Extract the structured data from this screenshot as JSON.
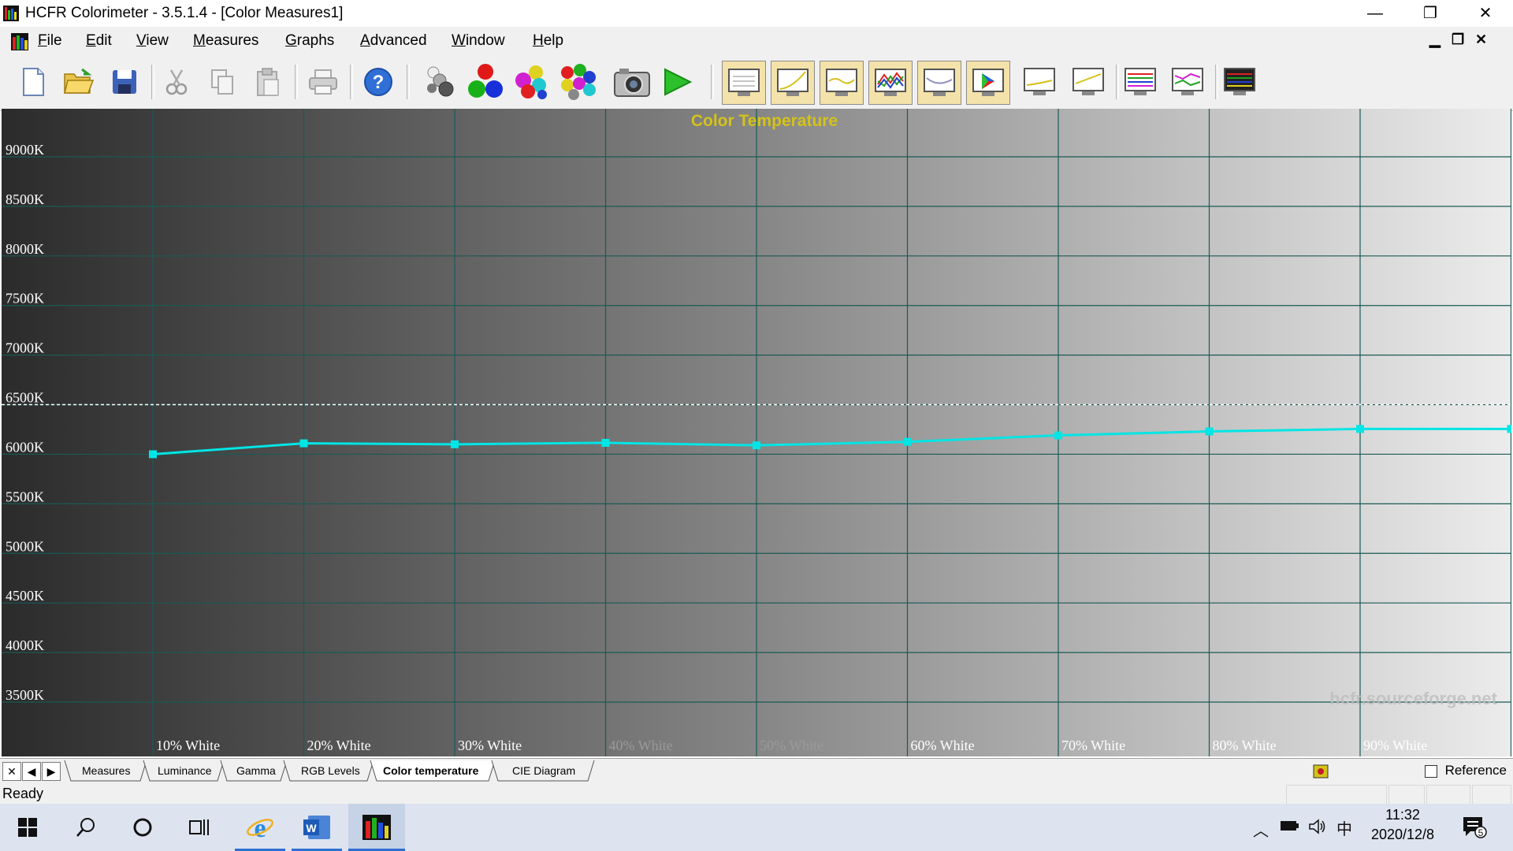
{
  "window": {
    "title": "HCFR Colorimeter - 3.5.1.4 - [Color Measures1]",
    "minimize_glyph": "—",
    "restore_glyph": "❐",
    "close_glyph": "✕"
  },
  "menu": {
    "items": [
      {
        "key": "F",
        "rest": "ile"
      },
      {
        "key": "E",
        "rest": "dit"
      },
      {
        "key": "V",
        "rest": "iew"
      },
      {
        "key": "M",
        "rest": "easures"
      },
      {
        "key": "G",
        "rest": "raphs"
      },
      {
        "key": "A",
        "rest": "dvanced"
      },
      {
        "key": "W",
        "rest": "indow"
      },
      {
        "key": "H",
        "rest": "elp"
      }
    ],
    "mdi": {
      "min": "▁",
      "restore": "❐",
      "close": "✕"
    }
  },
  "toolbar": {
    "buttons": [
      "new-document",
      "open-folder",
      "save",
      "cut",
      "copy",
      "paste",
      "print",
      "help",
      "grayscale-measure",
      "primaries-measure",
      "secondaries-measure",
      "all-colors-measure",
      "camera",
      "run"
    ],
    "graph_buttons": [
      "measures-view",
      "luminance-graph",
      "gamma-graph",
      "rgb-levels-graph",
      "color-temperature-graph",
      "cie-diagram",
      "near-black-graph",
      "near-white-graph",
      "saturation-graph",
      "saturation-shift-graph",
      "monitor-view"
    ]
  },
  "chart_data": {
    "type": "line",
    "title": "Color Temperature",
    "watermark": "hcfr.sourceforge.net",
    "y_tick_labels": [
      "3500K",
      "4000K",
      "4500K",
      "5000K",
      "5500K",
      "6000K",
      "6500K",
      "7000K",
      "7500K",
      "8000K",
      "8500K",
      "9000K"
    ],
    "x_tick_labels": [
      "10% White",
      "20% White",
      "30% White",
      "40% White",
      "50% White",
      "60% White",
      "70% White",
      "80% White",
      "90% White"
    ],
    "ylim": [
      3300,
      9500
    ],
    "reference": 6500,
    "x": [
      10,
      20,
      30,
      40,
      50,
      60,
      70,
      80,
      90,
      100
    ],
    "series": [
      {
        "values": [
          6000,
          6110,
          6100,
          6115,
          6090,
          6125,
          6190,
          6230,
          6255,
          6255
        ],
        "color": "#00e5e5"
      }
    ],
    "colors": {
      "grid": "#1a5a55",
      "reference": "#ffffff",
      "title": "#d4c21a"
    }
  },
  "tabs": {
    "nav": [
      "✕",
      "◀",
      "▶"
    ],
    "items": [
      "Measures",
      "Luminance",
      "Gamma",
      "RGB Levels",
      "Color temperature",
      "CIE Diagram"
    ],
    "active": "Color temperature",
    "reference_label": "Reference"
  },
  "status": {
    "text": "Ready"
  },
  "taskbar": {
    "time": "11:32",
    "date": "2020/12/8",
    "ime": "中",
    "notification_count": "5"
  }
}
